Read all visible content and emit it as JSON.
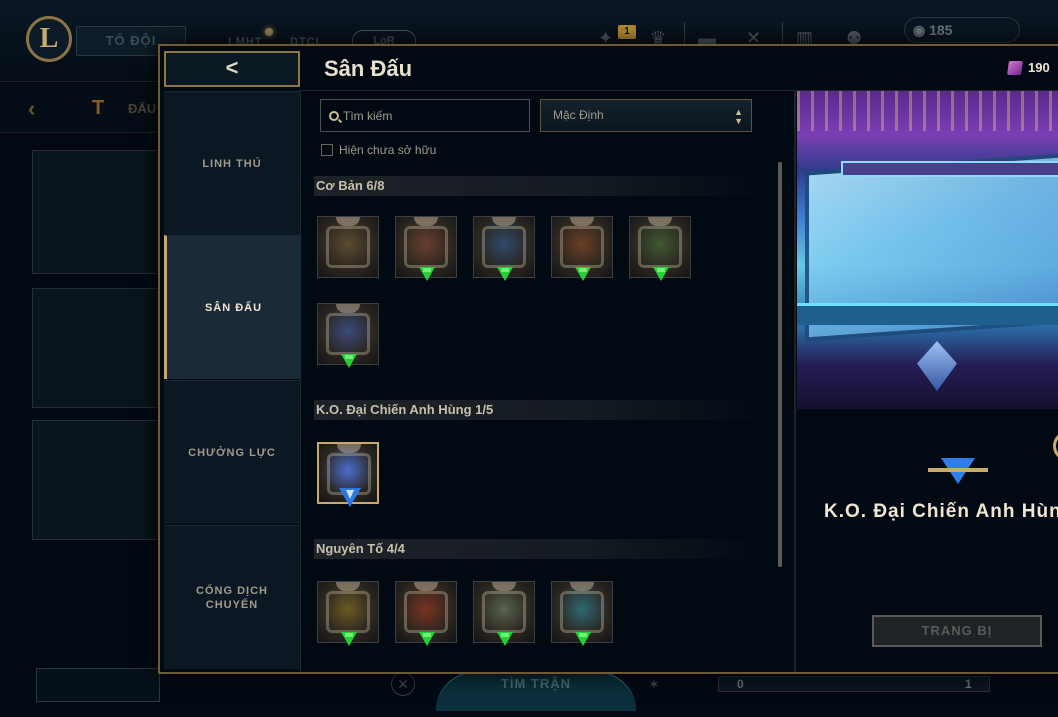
{
  "background": {
    "play_button": "TỐ ĐỘI",
    "nav_tabs": [
      "LMHT",
      "DTCL"
    ],
    "lor_tab": "LoR",
    "badge_count": "1",
    "currency": "185",
    "sub_title": "ĐẤU",
    "find_match": "TÌM TRẬN",
    "slider_min": "0",
    "slider_max": "1"
  },
  "modal": {
    "back_glyph": "<",
    "title": "Sân Đấu",
    "rp_amount": "190",
    "nav": [
      {
        "label": "LINH THÚ",
        "active": false
      },
      {
        "label": "SÂN ĐẤU",
        "active": true
      },
      {
        "label": "CHƯỞNG LỰC",
        "active": false
      },
      {
        "label": "CỔNG DỊCH CHUYỂN",
        "active": false
      }
    ],
    "search_placeholder": "Tìm kiếm",
    "sort_value": "Mặc Định",
    "show_unowned": "Hiện chưa sở hữu",
    "sections": [
      {
        "title": "Cơ Bản 6/8",
        "tiles": [
          "#5b4a2f",
          "#6a3f2e",
          "#2f4a6a",
          "#6b3f25",
          "#3f5a33",
          "#3b4a7a"
        ]
      },
      {
        "title": "K.O. Đại Chiến Anh Hùng 1/5",
        "tiles": [
          "#4b6fd0"
        ]
      },
      {
        "title": "Nguyên Tố 4/4",
        "tiles": [
          "#6b5a22",
          "#7a3320",
          "#5a6450",
          "#2f6a73"
        ]
      }
    ],
    "preview": {
      "name": "K.O. Đại Chiến Anh Hùng",
      "equip_label": "TRANG BỊ"
    }
  }
}
